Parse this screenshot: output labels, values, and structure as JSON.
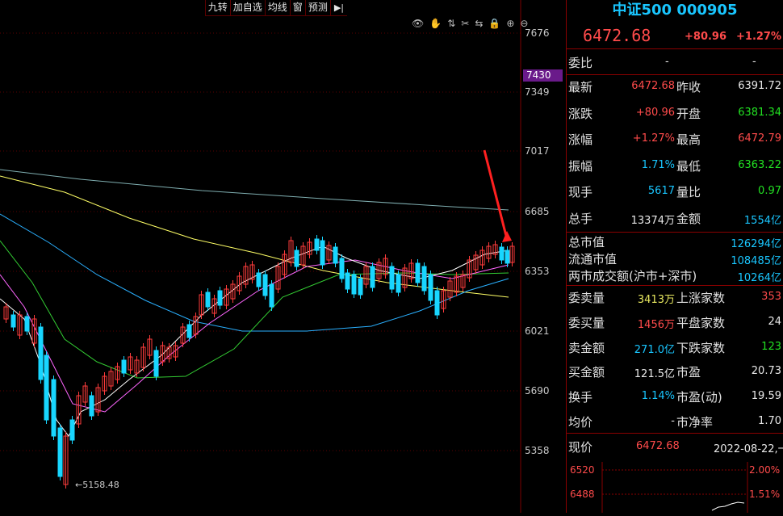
{
  "toolbar": {
    "items": [
      "九转",
      "加自选",
      "均线",
      "窗",
      "预测"
    ],
    "arrow": "▶|"
  },
  "chart": {
    "y_axis_labels": [
      "7676",
      "7349",
      "7017",
      "6685",
      "6353",
      "6021",
      "5690",
      "5358"
    ],
    "highlight_price": "7430",
    "low_annotation": "←5158.48"
  },
  "quote": {
    "title": "中证500 000905",
    "price": "6472.68",
    "change": "+80.96",
    "change_pct": "+1.27%",
    "weibi_label": "委比",
    "weibi_value": "-",
    "weibi_value2": "-",
    "rows": [
      {
        "l1": "最新",
        "v1": "6472.68",
        "l2": "昨收",
        "v2": "6391.72"
      },
      {
        "l1": "涨跌",
        "v1": "+80.96",
        "l2": "开盘",
        "v2": "6381.34"
      },
      {
        "l1": "涨幅",
        "v1": "+1.27%",
        "l2": "最高",
        "v2": "6472.79"
      },
      {
        "l1": "振幅",
        "v1": "1.71%",
        "l2": "最低",
        "v2": "6363.22"
      },
      {
        "l1": "现手",
        "v1": "5617",
        "l2": "量比",
        "v2": "0.97"
      },
      {
        "l1": "总手",
        "v1": "13374万",
        "l2": "金额",
        "v2": "1554亿"
      }
    ],
    "market": [
      {
        "l": "总市值",
        "v": "126294亿"
      },
      {
        "l": "流通市值",
        "v": "108485亿"
      },
      {
        "l": "两市成交额(沪市+深市)",
        "v": "10264亿"
      }
    ],
    "orders": [
      {
        "l1": "委卖量",
        "v1": "3413万",
        "l2": "上涨家数",
        "v2": "353"
      },
      {
        "l1": "委买量",
        "v1": "1456万",
        "l2": "平盘家数",
        "v2": "24"
      },
      {
        "l1": "卖金额",
        "v1": "271.0亿",
        "l2": "下跌家数",
        "v2": "123"
      },
      {
        "l1": "买金额",
        "v1": "121.5亿",
        "l2": "市盈",
        "v2": "20.73"
      },
      {
        "l1": "换手",
        "v1": "1.14%",
        "l2": "市盈(动)",
        "v2": "19.59"
      },
      {
        "l1": "均价",
        "v1": "-",
        "l2": "市净率",
        "v2": "1.70"
      }
    ],
    "now_label": "现价",
    "now_value": "6472.68",
    "date": "2022-08-22,一",
    "mini_axis_left": [
      "6520",
      "6488"
    ],
    "mini_axis_right": [
      "2.00%",
      "1.51%"
    ]
  },
  "colors": {
    "up": "#ff3c3c",
    "down": "#18d6ff",
    "ma1": "#ffffff",
    "ma2": "#ffff66",
    "ma3": "#ff66ff",
    "ma4": "#33cc33",
    "ma5": "#2ab0ff",
    "ma6": "#7faeb0"
  }
}
